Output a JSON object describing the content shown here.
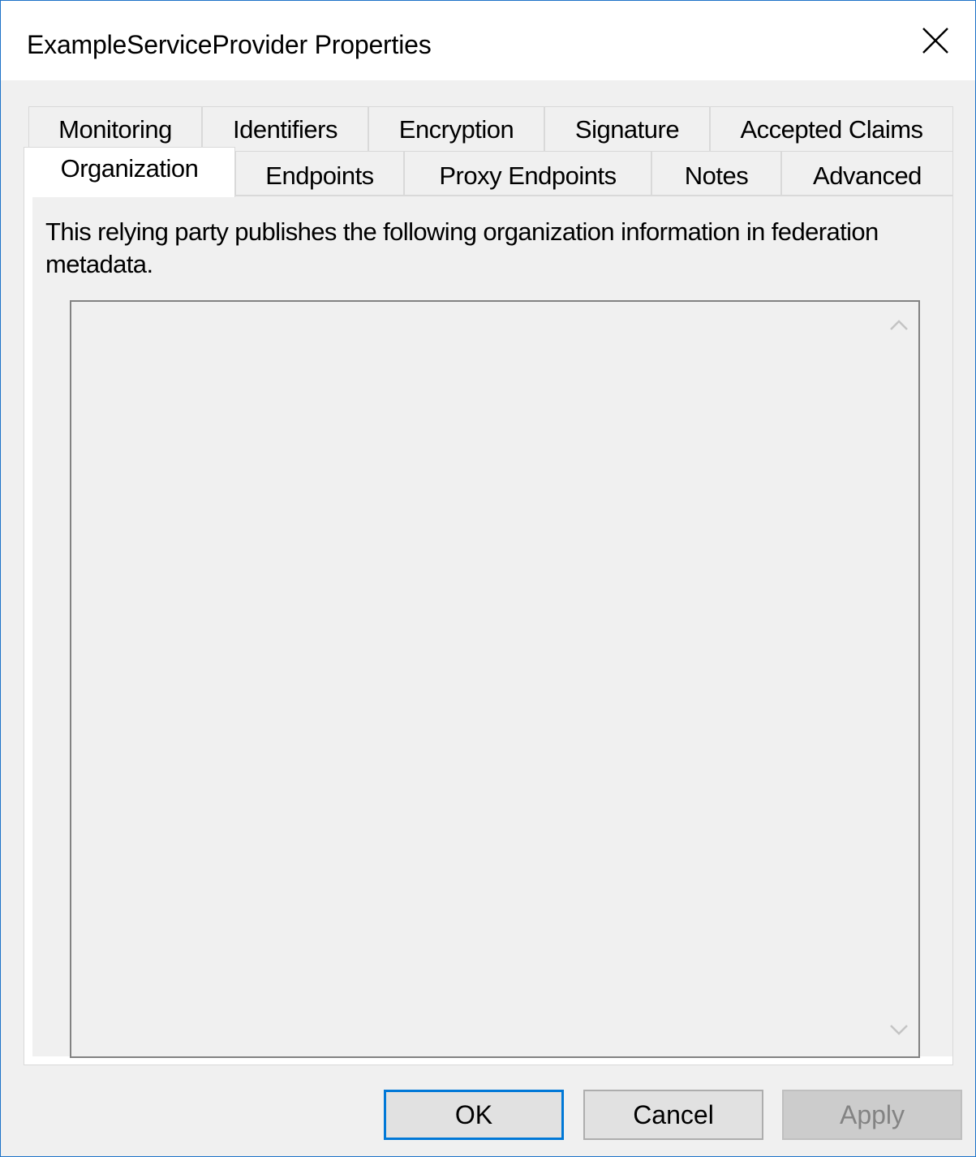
{
  "window": {
    "title": "ExampleServiceProvider Properties"
  },
  "tabs": {
    "row1": [
      "Monitoring",
      "Identifiers",
      "Encryption",
      "Signature",
      "Accepted Claims"
    ],
    "row2": [
      "Organization",
      "Endpoints",
      "Proxy Endpoints",
      "Notes",
      "Advanced"
    ],
    "active": "Organization"
  },
  "panel": {
    "description": "This relying party publishes the following organization information in federation metadata.",
    "list_items": []
  },
  "buttons": {
    "ok": "OK",
    "cancel": "Cancel",
    "apply": "Apply",
    "apply_enabled": false
  },
  "colors": {
    "window_border": "#1e73c8",
    "default_button_border": "#0078d7",
    "background": "#f0f0f0"
  },
  "icons": {
    "close": "close-icon",
    "scroll_up": "chevron-up-icon",
    "scroll_down": "chevron-down-icon"
  }
}
